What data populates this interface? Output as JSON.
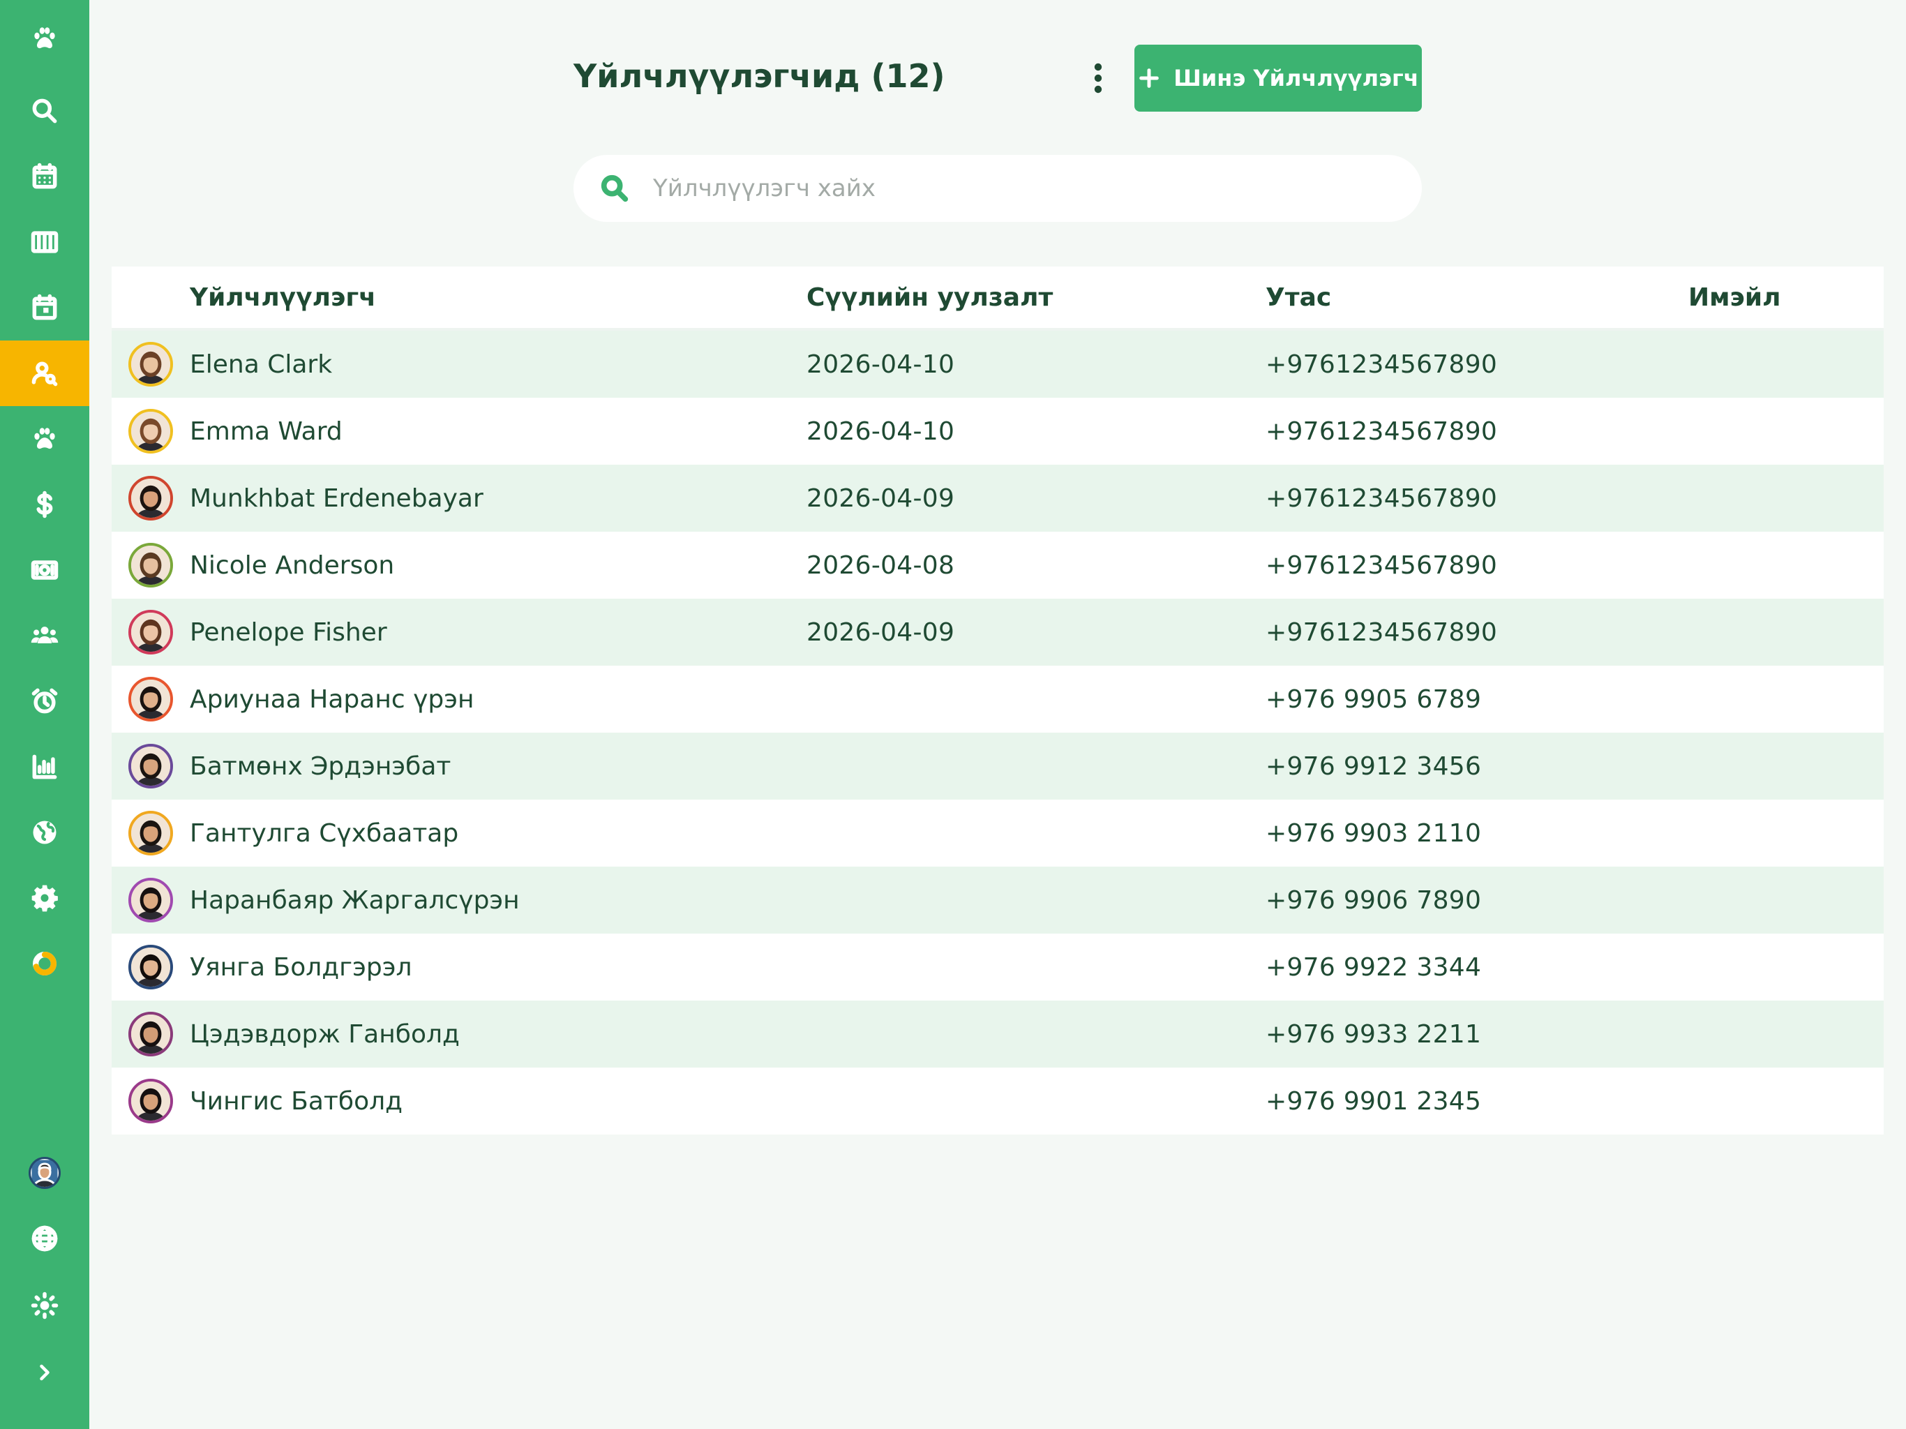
{
  "header": {
    "title": "Үйлчлүүлэгчид (12)",
    "new_button_label": "Шинэ Үйлчлүүлэгч"
  },
  "search": {
    "placeholder": "Үйлчлүүлэгч хайх",
    "value": ""
  },
  "sidebar": {
    "icons": [
      "paw-icon",
      "search-icon",
      "calendar-grid-icon",
      "columns-icon",
      "calendar-day-icon",
      "user-search-icon",
      "paw-icon",
      "dollar-icon",
      "cash-icon",
      "users-icon",
      "alarm-clock-icon",
      "bar-chart-icon",
      "globe-icon",
      "gear-icon",
      "donut-chart-icon"
    ],
    "active": "user-search-icon",
    "bottom_icons": [
      "user-avatar",
      "globe-language-icon",
      "sun-icon",
      "chevron-right-icon"
    ],
    "accent_color": "#3cb371",
    "active_color": "#f7b500"
  },
  "table": {
    "columns": [
      "Үйлчлүүлэгч",
      "Сүүлийн уулзалт",
      "Утас",
      "Имэйл"
    ],
    "rows": [
      {
        "name": "Elena Clark",
        "last_visit": "2026-04-10",
        "phone": "+9761234567890",
        "email": "",
        "ring": "#f0c020",
        "skin": "#e9c3a0",
        "hair": "#6b4026"
      },
      {
        "name": "Emma Ward",
        "last_visit": "2026-04-10",
        "phone": "+9761234567890",
        "email": "",
        "ring": "#f0c020",
        "skin": "#efcdb0",
        "hair": "#7a4a2a"
      },
      {
        "name": "Munkhbat Erdenebayar",
        "last_visit": "2026-04-09",
        "phone": "+9761234567890",
        "email": "",
        "ring": "#d0452e",
        "skin": "#d9a27c",
        "hair": "#1c1410"
      },
      {
        "name": "Nicole Anderson",
        "last_visit": "2026-04-08",
        "phone": "+9761234567890",
        "email": "",
        "ring": "#7aa83a",
        "skin": "#e6c0a0",
        "hair": "#5a3a22"
      },
      {
        "name": "Penelope Fisher",
        "last_visit": "2026-04-09",
        "phone": "+9761234567890",
        "email": "",
        "ring": "#d03a5a",
        "skin": "#ecc4a6",
        "hair": "#5e3520"
      },
      {
        "name": "Ариунаа Наранс үрэн",
        "last_visit": "",
        "phone": "+976 9905 6789",
        "email": "",
        "ring": "#e8562e",
        "skin": "#e0b08c",
        "hair": "#1a1210"
      },
      {
        "name": "Батмөнх Эрдэнэбат",
        "last_visit": "",
        "phone": "+976 9912 3456",
        "email": "",
        "ring": "#6a4a9a",
        "skin": "#d8a57e",
        "hair": "#1a1410"
      },
      {
        "name": "Гантулга Сүхбаатар",
        "last_visit": "",
        "phone": "+976 9903 2110",
        "email": "",
        "ring": "#f0a820",
        "skin": "#d9a37a",
        "hair": "#1a1410"
      },
      {
        "name": "Наранбаяр Жаргалсүрэн",
        "last_visit": "",
        "phone": "+976 9906 7890",
        "email": "",
        "ring": "#a04ab0",
        "skin": "#dcab84",
        "hair": "#161010"
      },
      {
        "name": "Уянга Болдгэрэл",
        "last_visit": "",
        "phone": "+976 9922 3344",
        "email": "",
        "ring": "#2a4a7a",
        "skin": "#e2b592",
        "hair": "#120c0a"
      },
      {
        "name": "Цэдэвдорж Ганболд",
        "last_visit": "",
        "phone": "+976 9933 2211",
        "email": "",
        "ring": "#8a3a7a",
        "skin": "#d29c76",
        "hair": "#161010"
      },
      {
        "name": "Чингис Батболд",
        "last_visit": "",
        "phone": "+976 9901 2345",
        "email": "",
        "ring": "#9a3a8a",
        "skin": "#d7a27b",
        "hair": "#151010"
      }
    ]
  }
}
